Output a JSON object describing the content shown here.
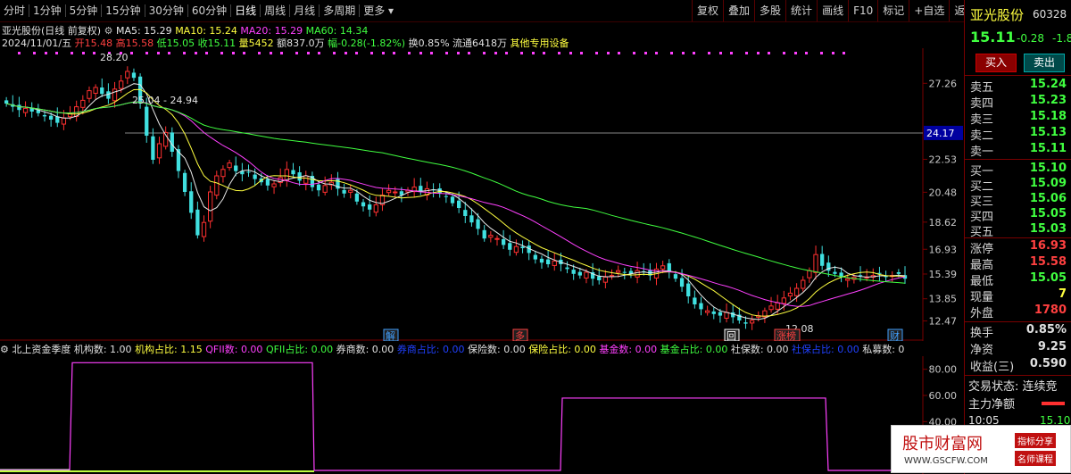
{
  "toolbar": {
    "periods": [
      "分时",
      "1分钟",
      "5分钟",
      "15分钟",
      "30分钟",
      "60分钟",
      "日线",
      "周线",
      "月线",
      "多周期",
      "更多"
    ],
    "active": "日线",
    "right": [
      "复权",
      "叠加",
      "多股",
      "统计",
      "画线",
      "F10",
      "标记",
      "+自选",
      "返回"
    ]
  },
  "info": {
    "name": "亚光股份(日线 前复权)",
    "ma5_label": "MA5: 15.29",
    "ma10_label": "MA10: 15.24",
    "ma20_label": "MA20: 15.29",
    "ma60_label": "MA60: 14.34",
    "date": "2024/11/01/五",
    "open": "开15.48",
    "high": "高15.58",
    "low": "低15.05",
    "close": "收15.11",
    "volume": "量5452",
    "amount": "额837.0万",
    "change": "幅-0.28(-1.82%)",
    "turnover": "换0.85%",
    "float": "流通6418万",
    "extra": "其他专用设备"
  },
  "axis": {
    "ticks": [
      "27.26",
      "22.53",
      "20.48",
      "18.62",
      "16.93",
      "15.39",
      "13.85",
      "12.47"
    ],
    "current_price": "24.17",
    "ind_ticks": [
      "80.00",
      "60.00",
      "40.00"
    ]
  },
  "annotations": {
    "high_label": "28.20",
    "range_label": "25.04 - 24.94",
    "low_label": "12.08",
    "markers": [
      "解",
      "多",
      "回",
      "涨榜",
      "财"
    ]
  },
  "indicator": {
    "title": "北上资金季度",
    "items": [
      {
        "t": "机构数: 1.00",
        "c": "#e0e0e0"
      },
      {
        "t": "机构占比: 1.15",
        "c": "#ffff40"
      },
      {
        "t": "QFII数: 0.00",
        "c": "#ff40ff"
      },
      {
        "t": "QFII占比: 0.00",
        "c": "#40ff40"
      },
      {
        "t": "券商数: 0.00",
        "c": "#e0e0e0"
      },
      {
        "t": "券商占比: 0.00",
        "c": "#2040ff"
      },
      {
        "t": "保险数: 0.00",
        "c": "#e0e0e0"
      },
      {
        "t": "保险占比: 0.00",
        "c": "#ffff40"
      },
      {
        "t": "基金数: 0.00",
        "c": "#ff40ff"
      },
      {
        "t": "基金占比: 0.00",
        "c": "#40ff40"
      },
      {
        "t": "社保数: 0.00",
        "c": "#e0e0e0"
      },
      {
        "t": "社保占比: 0.00",
        "c": "#2040ff"
      },
      {
        "t": "私募数: 0",
        "c": "#e0e0e0"
      }
    ]
  },
  "quote": {
    "name": "亚光股份",
    "code": "60328",
    "price": "15.11",
    "change": "-0.28",
    "pct": "-1.8",
    "buy": "买入",
    "sell": "卖出",
    "asks": [
      [
        "卖五",
        "15.24"
      ],
      [
        "卖四",
        "15.23"
      ],
      [
        "卖三",
        "15.18"
      ],
      [
        "卖二",
        "15.13"
      ],
      [
        "卖一",
        "15.11"
      ]
    ],
    "bids": [
      [
        "买一",
        "15.10"
      ],
      [
        "买二",
        "15.09"
      ],
      [
        "买三",
        "15.06"
      ],
      [
        "买四",
        "15.05"
      ],
      [
        "买五",
        "15.03"
      ]
    ],
    "stats": [
      [
        "涨停",
        "16.93",
        "#ff4040"
      ],
      [
        "最高",
        "15.58",
        "#ff4040"
      ],
      [
        "最低",
        "15.05",
        "#40ff40"
      ],
      [
        "现量",
        "7",
        "#ffff40"
      ],
      [
        "外盘",
        "1780",
        "#ff4040"
      ]
    ],
    "stats2": [
      [
        "换手",
        "0.85%"
      ],
      [
        "净资",
        "9.25"
      ],
      [
        "收益(三)",
        "0.590"
      ]
    ],
    "state": "交易状态: 连续竞",
    "main_force": "主力净额",
    "time": "10:05",
    "time_price": "15.10"
  },
  "watermark": {
    "main": "股市财富网",
    "url": "WWW.GSCFW.COM",
    "tag1": "指标分享",
    "tag2": "名师课程"
  },
  "chart_data": {
    "type": "candlestick",
    "ylim": [
      12.0,
      29.0
    ],
    "closes": [
      26.0,
      25.8,
      25.6,
      25.7,
      25.5,
      25.4,
      25.2,
      25.0,
      24.8,
      25.1,
      25.4,
      25.8,
      26.2,
      26.8,
      27.0,
      26.6,
      26.3,
      26.9,
      27.4,
      28.0,
      27.6,
      26.0,
      24.0,
      22.5,
      23.5,
      24.2,
      23.0,
      21.8,
      20.5,
      19.2,
      17.8,
      18.6,
      20.5,
      21.5,
      21.9,
      22.3,
      21.8,
      21.6,
      21.7,
      21.3,
      21.1,
      20.9,
      21.0,
      21.4,
      21.9,
      21.6,
      21.2,
      21.5,
      20.8,
      20.6,
      20.9,
      21.1,
      20.7,
      20.4,
      20.6,
      19.9,
      19.6,
      19.4,
      19.7,
      20.3,
      20.6,
      20.5,
      20.3,
      20.6,
      20.8,
      20.5,
      20.7,
      20.6,
      20.4,
      20.2,
      19.8,
      19.5,
      19.0,
      18.6,
      18.2,
      17.6,
      17.8,
      17.6,
      17.2,
      16.9,
      17.1,
      17.0,
      16.7,
      16.3,
      16.1,
      16.0,
      16.2,
      16.0,
      15.7,
      15.4,
      15.3,
      15.5,
      15.1,
      15.0,
      15.2,
      15.3,
      15.6,
      15.5,
      15.4,
      15.6,
      15.5,
      15.3,
      15.7,
      15.9,
      15.5,
      15.1,
      14.6,
      14.0,
      13.5,
      13.2,
      13.1,
      12.9,
      12.8,
      13.0,
      12.7,
      12.5,
      12.3,
      12.5,
      12.8,
      13.1,
      13.4,
      13.6,
      13.9,
      14.2,
      14.5,
      15.0,
      15.6,
      16.6,
      15.9,
      15.6,
      15.4,
      15.2,
      15.1,
      15.2,
      15.3,
      15.2,
      15.3,
      15.4,
      15.2,
      15.3,
      15.4,
      15.1
    ]
  }
}
